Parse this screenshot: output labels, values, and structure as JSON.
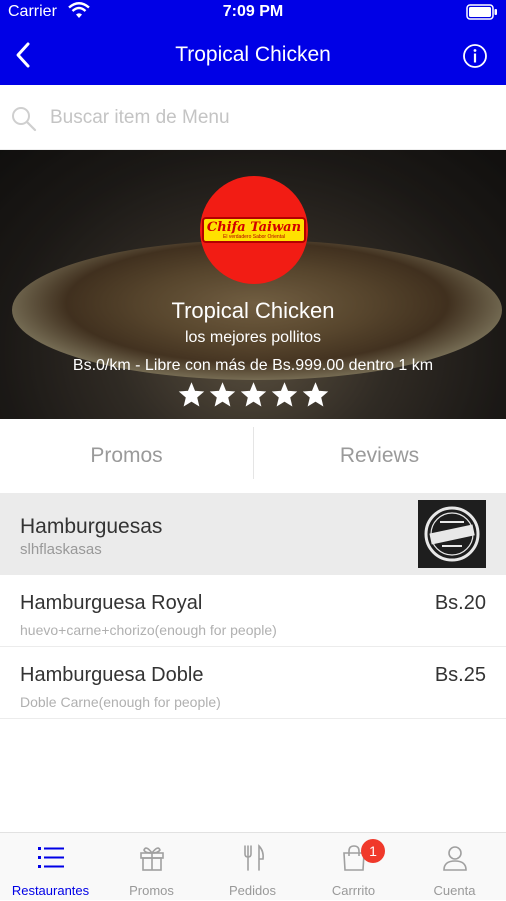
{
  "status_bar": {
    "carrier": "Carrier",
    "time": "7:09 PM"
  },
  "navbar": {
    "title": "Tropical Chicken",
    "back_icon": "chevron-left-icon",
    "info_icon": "info-circle-icon"
  },
  "search": {
    "placeholder": "Buscar item de Menu",
    "value": ""
  },
  "restaurant": {
    "logo_text": "Chifa Taiwan",
    "logo_tagline": "El verdadero Sabor Oriental",
    "name": "Tropical Chicken",
    "slogan": "los mejores pollitos",
    "delivery_info": "Bs.0/km - Libre con más de Bs.999.00 dentro 1 km",
    "rating": 5,
    "rating_max": 5
  },
  "segments": {
    "promos": "Promos",
    "reviews": "Reviews"
  },
  "category": {
    "title": "Hamburguesas",
    "subtitle": "slhflaskasas"
  },
  "menu_items": [
    {
      "name": "Hamburguesa Royal",
      "description": "huevo+carne+chorizo(enough for  people)",
      "price": "Bs.20"
    },
    {
      "name": "Hamburguesa Doble",
      "description": "Doble Carne(enough for  people)",
      "price": "Bs.25"
    }
  ],
  "tabbar": {
    "items": [
      {
        "label": "Restaurantes",
        "icon": "list-icon",
        "active": true
      },
      {
        "label": "Promos",
        "icon": "gift-icon",
        "active": false
      },
      {
        "label": "Pedidos",
        "icon": "fork-knife-icon",
        "active": false
      },
      {
        "label": "Carrrito",
        "icon": "shopping-bag-icon",
        "active": false,
        "badge": "1"
      },
      {
        "label": "Cuenta",
        "icon": "user-icon",
        "active": false
      }
    ]
  },
  "colors": {
    "primary": "#0000e6",
    "badge": "#f0392b",
    "logo_red": "#f21c14",
    "logo_yellow": "#ffe100"
  }
}
